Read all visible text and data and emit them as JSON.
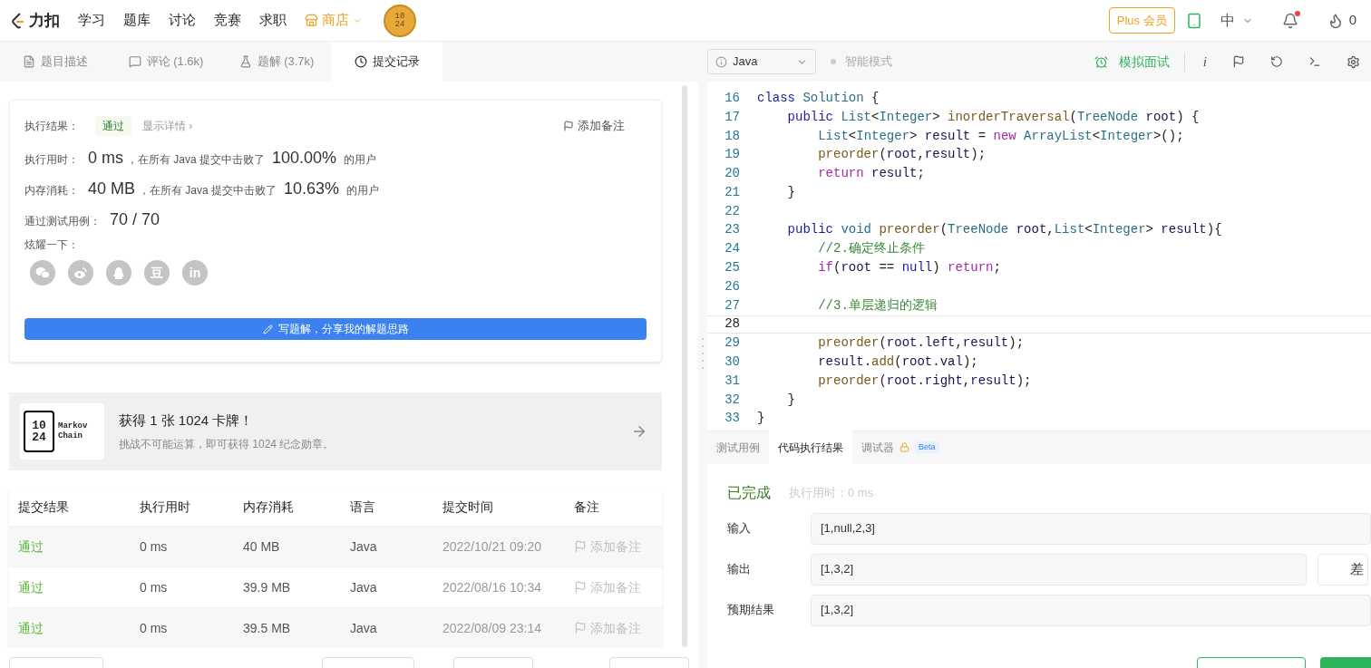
{
  "nav": {
    "logo": "力扣",
    "items": [
      {
        "label": "学习",
        "kind": "link"
      },
      {
        "label": "题库",
        "kind": "link"
      },
      {
        "label": "讨论",
        "kind": "link"
      },
      {
        "label": "竞赛",
        "kind": "link"
      },
      {
        "label": "求职",
        "kind": "link"
      },
      {
        "label": "商店",
        "kind": "store"
      }
    ],
    "coin": [
      "10",
      "24"
    ],
    "plus": "Plus 会员",
    "lang": "中",
    "notify_dot": true,
    "streak": "0"
  },
  "left_tabs": [
    {
      "label": "题目描述",
      "selected": false
    },
    {
      "label": "评论 (1.6k)",
      "selected": false
    },
    {
      "label": "题解 (3.7k)",
      "selected": false
    },
    {
      "label": "提交记录",
      "selected": true
    }
  ],
  "result": {
    "label": "执行结果：",
    "status": "通过",
    "details": "显示详情 ›",
    "note": "添加备注",
    "metrics": [
      {
        "label": "执行用时：",
        "value": "0 ms",
        "text": "，在所有 Java 提交中击败了",
        "percent": "100.00%",
        "suffix": "的用户"
      },
      {
        "label": "内存消耗：",
        "value": "40 MB",
        "text": "，在所有 Java 提交中击败了",
        "percent": "10.63%",
        "suffix": "的用户"
      }
    ],
    "tests_label": "通过测试用例：",
    "tests": "70 / 70",
    "share_label": "炫耀一下：",
    "share": [
      {
        "kind": "wechat"
      },
      {
        "kind": "weibo"
      },
      {
        "kind": "qq"
      },
      {
        "kind": "glyph",
        "label": "豆"
      },
      {
        "kind": "glyph",
        "label": "in"
      }
    ],
    "write_button": "写题解，分享我的解题思路"
  },
  "promo": {
    "tile": [
      "10",
      "24"
    ],
    "card_text": [
      "Markov",
      "Chain"
    ],
    "title": "获得 1 张 1024 卡牌！",
    "subtitle": "挑战不可能运算，即可获得 1024 纪念勋章。"
  },
  "table": {
    "columns": [
      "提交结果",
      "执行用时",
      "内存消耗",
      "语言",
      "提交时间",
      "备注"
    ],
    "rows": [
      {
        "result": "通过",
        "time": "0 ms",
        "memory": "40 MB",
        "lang": "Java",
        "submitted": "2022/10/21 09:20",
        "note": "添加备注"
      },
      {
        "result": "通过",
        "time": "0 ms",
        "memory": "39.9 MB",
        "lang": "Java",
        "submitted": "2022/08/16 10:34",
        "note": "添加备注"
      },
      {
        "result": "通过",
        "time": "0 ms",
        "memory": "39.5 MB",
        "lang": "Java",
        "submitted": "2022/08/09 23:14",
        "note": "添加备注"
      }
    ]
  },
  "editor": {
    "language": "Java",
    "mode": "智能模式",
    "interview": "模拟面试",
    "info": "i",
    "lines": [
      {
        "n": "16",
        "active": false,
        "code": [
          {
            "kind": "k",
            "text": "class"
          },
          {
            "kind": "t",
            "text": " Solution"
          },
          {
            "kind": "p",
            "text": " {"
          }
        ]
      },
      {
        "n": "17",
        "active": false,
        "code": [
          {
            "kind": "k",
            "text": "    public"
          },
          {
            "kind": "t",
            "text": " List"
          },
          {
            "kind": "p",
            "text": "<"
          },
          {
            "kind": "t",
            "text": "Integer"
          },
          {
            "kind": "p",
            "text": ">"
          },
          {
            "kind": "f",
            "text": " inorderTraversal"
          },
          {
            "kind": "p",
            "text": "("
          },
          {
            "kind": "t",
            "text": "TreeNode"
          },
          {
            "kind": "v",
            "text": " root"
          },
          {
            "kind": "p",
            "text": ") {"
          }
        ]
      },
      {
        "n": "18",
        "active": false,
        "code": [
          {
            "kind": "t",
            "text": "        List"
          },
          {
            "kind": "p",
            "text": "<"
          },
          {
            "kind": "t",
            "text": "Integer"
          },
          {
            "kind": "p",
            "text": ">"
          },
          {
            "kind": "v",
            "text": " result"
          },
          {
            "kind": "p",
            "text": " ="
          },
          {
            "kind": "r",
            "text": " new"
          },
          {
            "kind": "t",
            "text": " ArrayList"
          },
          {
            "kind": "p",
            "text": "<"
          },
          {
            "kind": "t",
            "text": "Integer"
          },
          {
            "kind": "p",
            "text": ">();"
          }
        ]
      },
      {
        "n": "19",
        "active": false,
        "code": [
          {
            "kind": "f",
            "text": "        preorder"
          },
          {
            "kind": "p",
            "text": "("
          },
          {
            "kind": "v",
            "text": "root"
          },
          {
            "kind": "p",
            "text": ","
          },
          {
            "kind": "v",
            "text": "result"
          },
          {
            "kind": "p",
            "text": ");"
          }
        ]
      },
      {
        "n": "20",
        "active": false,
        "code": [
          {
            "kind": "r",
            "text": "        return"
          },
          {
            "kind": "v",
            "text": " result"
          },
          {
            "kind": "p",
            "text": ";"
          }
        ]
      },
      {
        "n": "21",
        "active": false,
        "code": [
          {
            "kind": "p",
            "text": "    }"
          }
        ]
      },
      {
        "n": "22",
        "active": false
      },
      {
        "n": "23",
        "active": false,
        "code": [
          {
            "kind": "k",
            "text": "    public"
          },
          {
            "kind": "t",
            "text": " void"
          },
          {
            "kind": "f",
            "text": " preorder"
          },
          {
            "kind": "p",
            "text": "("
          },
          {
            "kind": "t",
            "text": "TreeNode"
          },
          {
            "kind": "v",
            "text": " root"
          },
          {
            "kind": "p",
            "text": ","
          },
          {
            "kind": "t",
            "text": "List"
          },
          {
            "kind": "p",
            "text": "<"
          },
          {
            "kind": "t",
            "text": "Integer"
          },
          {
            "kind": "p",
            "text": ">"
          },
          {
            "kind": "v",
            "text": " result"
          },
          {
            "kind": "p",
            "text": "){"
          }
        ]
      },
      {
        "n": "24",
        "active": false,
        "code": [
          {
            "kind": "c",
            "text": "        //2.确定终止条件"
          }
        ]
      },
      {
        "n": "25",
        "active": false,
        "code": [
          {
            "kind": "r",
            "text": "        if"
          },
          {
            "kind": "p",
            "text": "("
          },
          {
            "kind": "v",
            "text": "root"
          },
          {
            "kind": "p",
            "text": " =="
          },
          {
            "kind": "k",
            "text": " null"
          },
          {
            "kind": "p",
            "text": ")"
          },
          {
            "kind": "r",
            "text": " return"
          },
          {
            "kind": "p",
            "text": ";"
          }
        ]
      },
      {
        "n": "26",
        "active": false
      },
      {
        "n": "27",
        "active": false,
        "code": [
          {
            "kind": "c",
            "text": "        //3.单层递归的逻辑"
          }
        ]
      },
      {
        "n": "28",
        "active": true
      },
      {
        "n": "29",
        "active": false,
        "code": [
          {
            "kind": "f",
            "text": "        preorder"
          },
          {
            "kind": "p",
            "text": "("
          },
          {
            "kind": "v",
            "text": "root"
          },
          {
            "kind": "p",
            "text": "."
          },
          {
            "kind": "v",
            "text": "left"
          },
          {
            "kind": "p",
            "text": ","
          },
          {
            "kind": "v",
            "text": "result"
          },
          {
            "kind": "p",
            "text": ");"
          }
        ]
      },
      {
        "n": "30",
        "active": false,
        "code": [
          {
            "kind": "v",
            "text": "        result"
          },
          {
            "kind": "p",
            "text": "."
          },
          {
            "kind": "f",
            "text": "add"
          },
          {
            "kind": "p",
            "text": "("
          },
          {
            "kind": "v",
            "text": "root"
          },
          {
            "kind": "p",
            "text": "."
          },
          {
            "kind": "v",
            "text": "val"
          },
          {
            "kind": "p",
            "text": ");"
          }
        ]
      },
      {
        "n": "31",
        "active": false,
        "code": [
          {
            "kind": "f",
            "text": "        preorder"
          },
          {
            "kind": "p",
            "text": "("
          },
          {
            "kind": "v",
            "text": "root"
          },
          {
            "kind": "p",
            "text": "."
          },
          {
            "kind": "v",
            "text": "right"
          },
          {
            "kind": "p",
            "text": ","
          },
          {
            "kind": "v",
            "text": "result"
          },
          {
            "kind": "p",
            "text": ");"
          }
        ]
      },
      {
        "n": "32",
        "active": false,
        "code": [
          {
            "kind": "p",
            "text": "    }"
          }
        ]
      },
      {
        "n": "33",
        "active": false,
        "code": [
          {
            "kind": "p",
            "text": "}"
          }
        ]
      }
    ]
  },
  "console": {
    "tabs": [
      {
        "label": "测试用例",
        "selected": false,
        "locked": false
      },
      {
        "label": "代码执行结果",
        "selected": true,
        "locked": false
      },
      {
        "label": "调试器",
        "selected": false,
        "locked": true,
        "badge": "Beta"
      }
    ],
    "status": "已完成",
    "runtime": "执行用时：0 ms",
    "fields": [
      {
        "label": "输入",
        "value": "[1,null,2,3]"
      },
      {
        "label": "输出",
        "value": "[1,3,2]",
        "diff": "差"
      },
      {
        "label": "预期结果",
        "value": "[1,3,2]"
      }
    ]
  }
}
